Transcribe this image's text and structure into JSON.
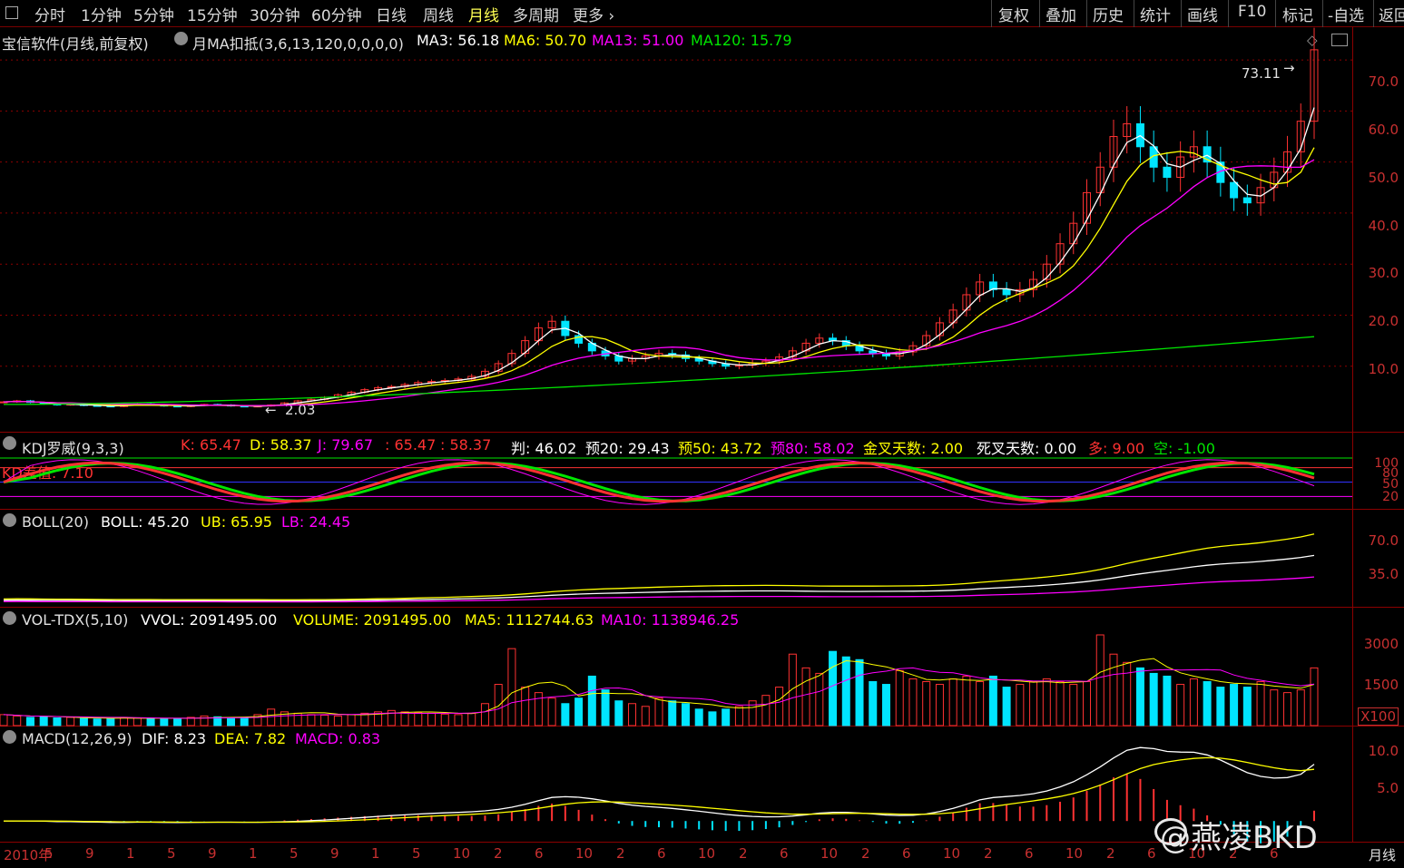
{
  "toolbar": {
    "timeframes": [
      "分时",
      "1分钟",
      "5分钟",
      "15分钟",
      "30分钟",
      "60分钟",
      "日线",
      "周线",
      "月线",
      "多周期",
      "更多 ›"
    ],
    "active": "月线",
    "tools": [
      "复权",
      "叠加",
      "历史",
      "统计",
      "画线",
      "F10",
      "标记",
      "-自选",
      "返回"
    ]
  },
  "main_panel": {
    "stock_title": "宝信软件(月线,前复权)",
    "indicator_name": "月MA扣抵(3,6,13,120,0,0,0,0)",
    "ma3": "MA3: 56.18",
    "ma6": "MA6: 50.70",
    "ma13": "MA13: 51.00",
    "ma120": "MA120: 15.79",
    "high_label": "73.11",
    "low_label": "2.03",
    "y_ticks": [
      "70.0",
      "60.0",
      "50.0",
      "40.0",
      "30.0",
      "20.0",
      "10.0"
    ]
  },
  "kdj_panel": {
    "name": "KDJ罗威(9,3,3)",
    "k": "K: 65.47",
    "d": "D: 58.37",
    "j": "J: 79.67",
    "v1": ": 65.47",
    "v2": ": 58.37",
    "pan": "判: 46.02",
    "yu20": "预20: 29.43",
    "yu50": "预50: 43.72",
    "yu80": "预80: 58.02",
    "gold": "金叉天数: 2.00",
    "dead": "死叉天数: 0.00",
    "duo": "多: 9.00",
    "kong": "空: -1.00",
    "kd_diff": "KD差值: 7.10",
    "y_ticks": [
      "100",
      "80",
      "50",
      "20"
    ]
  },
  "boll_panel": {
    "name": "BOLL(20)",
    "boll": "BOLL: 45.20",
    "ub": "UB: 65.95",
    "lb": "LB: 24.45",
    "y_ticks": [
      "70.0",
      "35.0"
    ]
  },
  "vol_panel": {
    "name": "VOL-TDX(5,10)",
    "vvol": "VVOL: 2091495.00",
    "volume": "VOLUME: 2091495.00",
    "ma5": "MA5: 1112744.63",
    "ma10": "MA10: 1138946.25",
    "y_ticks": [
      "3000",
      "1500"
    ],
    "unit": "X100"
  },
  "macd_panel": {
    "name": "MACD(12,26,9)",
    "dif": "DIF: 8.23",
    "dea": "DEA: 7.82",
    "macd": "MACD: 0.83",
    "y_ticks": [
      "10.0",
      "5.0"
    ]
  },
  "x_axis": {
    "labels": [
      "2010年",
      "5",
      "9",
      "1",
      "5",
      "9",
      "1",
      "5",
      "9",
      "1",
      "5",
      "10",
      "2",
      "6",
      "10",
      "2",
      "6",
      "10",
      "2",
      "6",
      "10",
      "2",
      "6",
      "10",
      "2",
      "6",
      "10",
      "2",
      "6",
      "10",
      "2",
      "6"
    ],
    "period": "月线"
  },
  "watermark": "@燕凌BKD",
  "colors": {
    "up": "#ff3232",
    "down": "#00e5ff",
    "ma3": "#ffffff",
    "ma6": "#ffff00",
    "ma13": "#ff00ff",
    "ma120": "#00e600",
    "grid": "#8c0000"
  },
  "chart_data": {
    "type": "candlestick",
    "series": [
      {
        "name": "MA3",
        "last": 56.18
      },
      {
        "name": "MA6",
        "last": 50.7
      },
      {
        "name": "MA13",
        "last": 51.0
      },
      {
        "name": "MA120",
        "last": 15.79
      }
    ],
    "price_range": [
      0,
      75
    ],
    "price_max": 73.11,
    "price_min": 2.03,
    "close_path": [
      3.0,
      3.2,
      2.9,
      2.6,
      2.4,
      2.6,
      2.3,
      2.2,
      2.1,
      2.4,
      2.6,
      2.4,
      2.2,
      2.1,
      2.3,
      2.5,
      2.4,
      2.2,
      2.1,
      2.2,
      2.4,
      2.8,
      3.2,
      3.5,
      3.9,
      4.4,
      4.9,
      5.4,
      5.8,
      6.0,
      6.4,
      6.8,
      7.0,
      7.2,
      7.5,
      8.0,
      9.0,
      10.5,
      12.5,
      15.0,
      17.5,
      18.8,
      16.0,
      14.5,
      13.0,
      12.0,
      11.0,
      11.5,
      12.0,
      12.5,
      12.2,
      11.5,
      11.0,
      10.5,
      10.0,
      10.2,
      10.6,
      11.0,
      11.8,
      13.0,
      14.5,
      15.5,
      15.0,
      14.0,
      13.0,
      12.5,
      12.0,
      12.8,
      14.0,
      16.0,
      18.5,
      21.0,
      24.0,
      26.5,
      25.0,
      24.0,
      25.0,
      27.0,
      30.0,
      34.0,
      38.0,
      44.0,
      49.0,
      55.0,
      57.5,
      53.0,
      49.0,
      47.0,
      51.0,
      53.0,
      50.0,
      46.0,
      43.0,
      42.0,
      45.0,
      48.0,
      52.0,
      58.0,
      72.0
    ],
    "kdj": {
      "K": 65.47,
      "D": 58.37,
      "J": 79.67,
      "range": [
        0,
        100
      ]
    },
    "boll": {
      "BOLL": 45.2,
      "UB": 65.95,
      "LB": 24.45,
      "range": [
        0,
        75
      ]
    },
    "volume": {
      "VOLUME": 2091495.0,
      "MA5": 1112744.63,
      "MA10": 1138946.25,
      "unit": "X100",
      "bars": [
        400,
        350,
        300,
        320,
        280,
        300,
        260,
        240,
        250,
        300,
        280,
        260,
        240,
        250,
        300,
        350,
        320,
        280,
        300,
        400,
        600,
        500,
        450,
        400,
        380,
        350,
        400,
        450,
        500,
        550,
        500,
        480,
        450,
        420,
        400,
        450,
        800,
        1500,
        2800,
        1400,
        1200,
        1000,
        800,
        1000,
        1800,
        1300,
        900,
        800,
        700,
        1000,
        900,
        800,
        600,
        500,
        600,
        700,
        900,
        1100,
        1400,
        2600,
        2100,
        1900,
        2700,
        2500,
        2400,
        1600,
        1500,
        2000,
        1700,
        1600,
        1500,
        1700,
        1800,
        1600,
        1800,
        1400,
        1500,
        1600,
        1700,
        1600,
        1500,
        1600,
        3300,
        2600,
        2300,
        2100,
        1900,
        1800,
        1500,
        1700,
        1600,
        1400,
        1500,
        1400,
        1600,
        1300,
        1200,
        1300,
        2100
      ]
    },
    "macd": {
      "DIF": 8.23,
      "DEA": 7.82,
      "MACD": 0.83,
      "range": [
        -3,
        12
      ]
    }
  }
}
